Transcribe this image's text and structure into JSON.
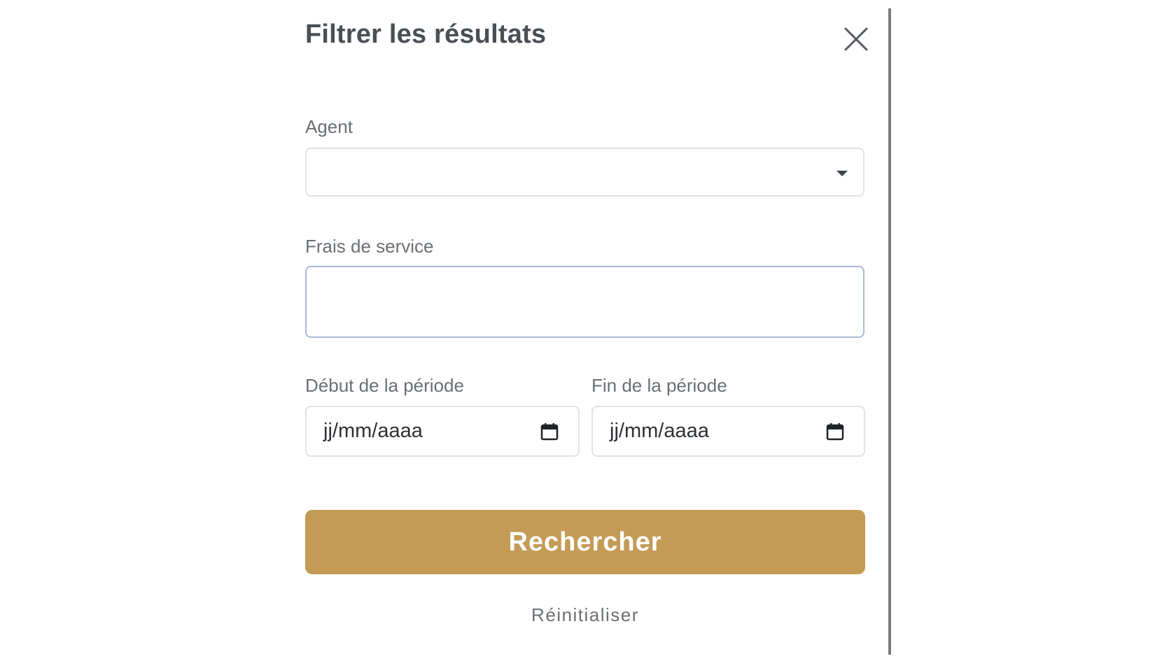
{
  "panel": {
    "title": "Filtrer les résultats",
    "close_icon": "close-icon"
  },
  "fields": {
    "agent": {
      "label": "Agent",
      "value": "",
      "icon": "chevron-down-icon"
    },
    "service_fee": {
      "label": "Frais de service",
      "value": ""
    },
    "period_start": {
      "label": "Début de la période",
      "placeholder": "jj/mm/aaaa",
      "icon": "calendar-icon"
    },
    "period_end": {
      "label": "Fin de la période",
      "placeholder": "jj/mm/aaaa",
      "icon": "calendar-icon"
    }
  },
  "actions": {
    "search_label": "Rechercher",
    "reset_label": "Réinitialiser"
  },
  "colors": {
    "accent": "#c49b55",
    "focus_border": "#a9b8d6",
    "divider": "#7c7c7c"
  }
}
